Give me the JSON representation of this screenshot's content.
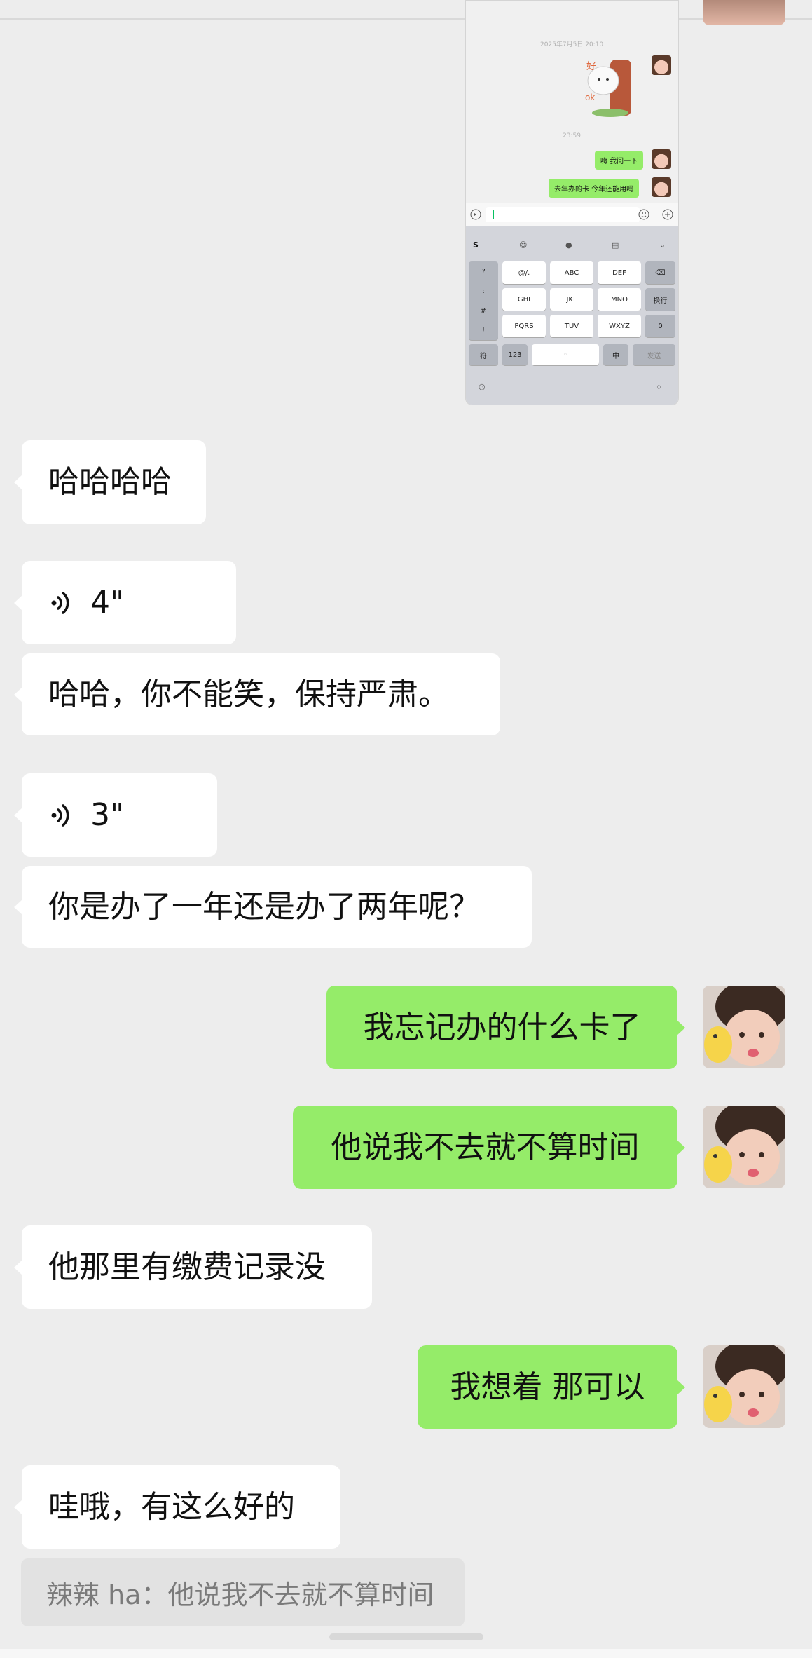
{
  "embedded_screenshot": {
    "header_text": "",
    "timestamp_1": "2025年7月5日 20:10",
    "timestamp_2": "23:59",
    "sent_messages": [
      "嗨 我问一下",
      "去年办的卡 今年还能用吗"
    ],
    "keyboard": {
      "left_column": [
        "?",
        ":",
        "#",
        "!"
      ],
      "row1": [
        "@/.",
        "ABC",
        "DEF"
      ],
      "row2": [
        "GHI",
        "JKL",
        "MNO"
      ],
      "row3": [
        "PQRS",
        "TUV",
        "WXYZ"
      ],
      "right_column": [
        "换行",
        "0"
      ],
      "bottom_row": [
        "符",
        "123",
        "中",
        "发送"
      ]
    }
  },
  "messages": [
    {
      "side": "in",
      "type": "text",
      "text": "哈哈哈哈"
    },
    {
      "side": "in",
      "type": "voice",
      "duration": "4\""
    },
    {
      "side": "in",
      "type": "text",
      "text": "哈哈，你不能笑，保持严肃。"
    },
    {
      "side": "in",
      "type": "voice",
      "duration": "3\""
    },
    {
      "side": "in",
      "type": "text",
      "text": "你是办了一年还是办了两年呢？"
    },
    {
      "side": "out",
      "type": "text",
      "text": "我忘记办的什么卡了"
    },
    {
      "side": "out",
      "type": "text",
      "text": "他说我不去就不算时间"
    },
    {
      "side": "in",
      "type": "text",
      "text": "他那里有缴费记录没"
    },
    {
      "side": "out",
      "type": "text",
      "text": "我想着 那可以"
    },
    {
      "side": "in",
      "type": "text",
      "text": "哇哦，有这么好的"
    }
  ],
  "quote": {
    "text": "辣辣 ha：他说我不去就不算时间"
  },
  "colors": {
    "outgoing_bubble": "#95ec69",
    "incoming_bubble": "#ffffff",
    "background": "#ededed",
    "quote_bg": "#e2e2e2"
  },
  "icons": [
    "voice-icon",
    "emoji-icon",
    "plus-icon",
    "mic-icon",
    "globe-icon",
    "backspace-icon"
  ]
}
